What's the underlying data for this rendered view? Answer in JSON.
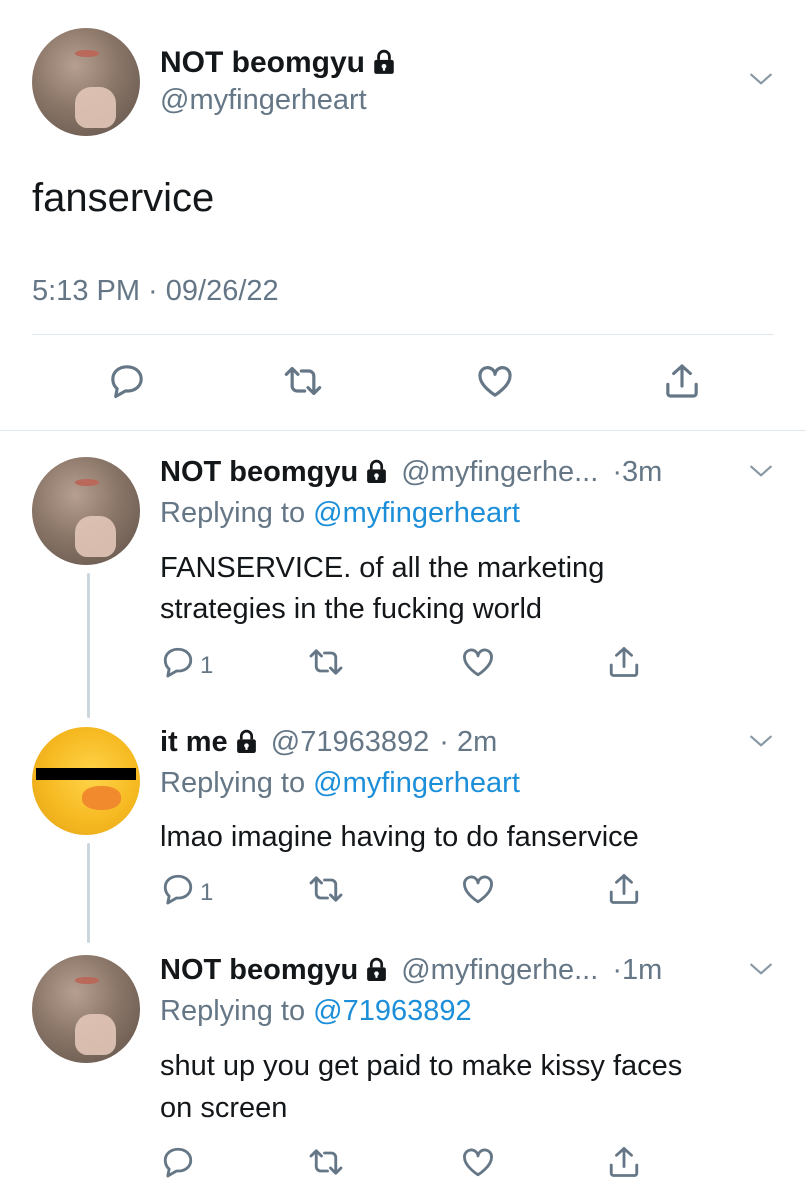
{
  "main_tweet": {
    "display_name": "NOT beomgyu",
    "handle": "@myfingerheart",
    "text": "fanservice",
    "timestamp": "5:13 PM · 09/26/22"
  },
  "replies": [
    {
      "display_name": "NOT beomgyu",
      "handle": "@myfingerhe...",
      "time": "·3m",
      "replying_prefix": "Replying to",
      "replying_to": "@myfingerheart",
      "text_line1": "FANSERVICE. of all the marketing",
      "text_line2": "strategies in the fucking world",
      "reply_count": "1"
    },
    {
      "display_name": "it me",
      "handle": "@71963892",
      "time": "· 2m",
      "replying_prefix": "Replying to",
      "replying_to": "@myfingerheart",
      "text_line1": "lmao imagine having to do fanservice",
      "reply_count": "1"
    },
    {
      "display_name": "NOT beomgyu",
      "handle": "@myfingerhe...",
      "time": "·1m",
      "replying_prefix": "Replying to",
      "replying_to": "@71963892",
      "text_line1": "shut up you get paid to make kissy faces",
      "text_line2": "on screen"
    }
  ],
  "icons": [
    "lock-icon",
    "chevron-down-icon",
    "reply-icon",
    "retweet-icon",
    "like-icon",
    "share-icon"
  ],
  "colors": {
    "text": "#14171a",
    "secondary": "#657786",
    "link": "#1d8fd9",
    "divider": "#e1e8ed",
    "thread": "#ccd6dd"
  }
}
